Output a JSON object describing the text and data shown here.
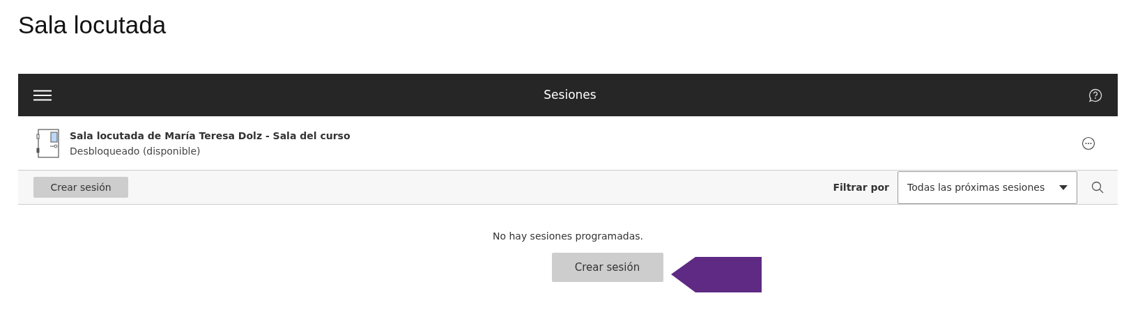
{
  "page_title": "Sala locutada",
  "header": {
    "title": "Sesiones"
  },
  "room": {
    "name": "Sala locutada de María Teresa Dolz - Sala del curso",
    "status": "Desbloqueado (disponible)"
  },
  "toolbar": {
    "create_button": "Crear sesión",
    "filter_label": "Filtrar por",
    "filter_value": "Todas las próximas sesiones"
  },
  "empty_state": {
    "message": "No hay sesiones programadas.",
    "button": "Crear sesión"
  }
}
